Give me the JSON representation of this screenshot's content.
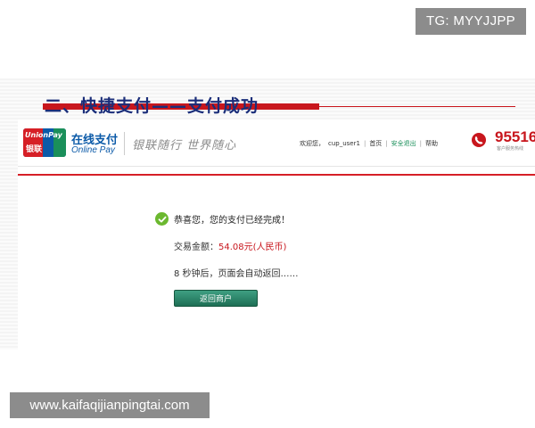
{
  "watermark_top": "TG: MYYJJPP",
  "slide": {
    "title": "二、快捷支付——支付成功"
  },
  "header": {
    "logo_text_en": "UnionPay",
    "logo_text_cn": "银联",
    "online_pay_cn": "在线支付",
    "online_pay_en": "Online Pay",
    "slogan": "银联随行 世界随心",
    "nav": {
      "welcome": "欢迎您，",
      "user": "cup_user1",
      "home": "首页",
      "secure_logout": "安全退出",
      "help": "帮助"
    },
    "hotline": "95516",
    "hotline_sub": "客户服务热线"
  },
  "result": {
    "success_message": "恭喜您，您的支付已经完成！",
    "amount_label": "交易金额：",
    "amount_value": "54.08",
    "amount_unit": "元(人民币)",
    "countdown": "8 秒钟后，页面会自动返回……",
    "return_button": "返回商户"
  },
  "watermark_bottom": "www.kaifaqijianpingtai.com",
  "colors": {
    "brand_red": "#c8161d",
    "brand_blue": "#0b5aa8",
    "success_green": "#6bb82f",
    "button_green": "#1e6f55"
  }
}
